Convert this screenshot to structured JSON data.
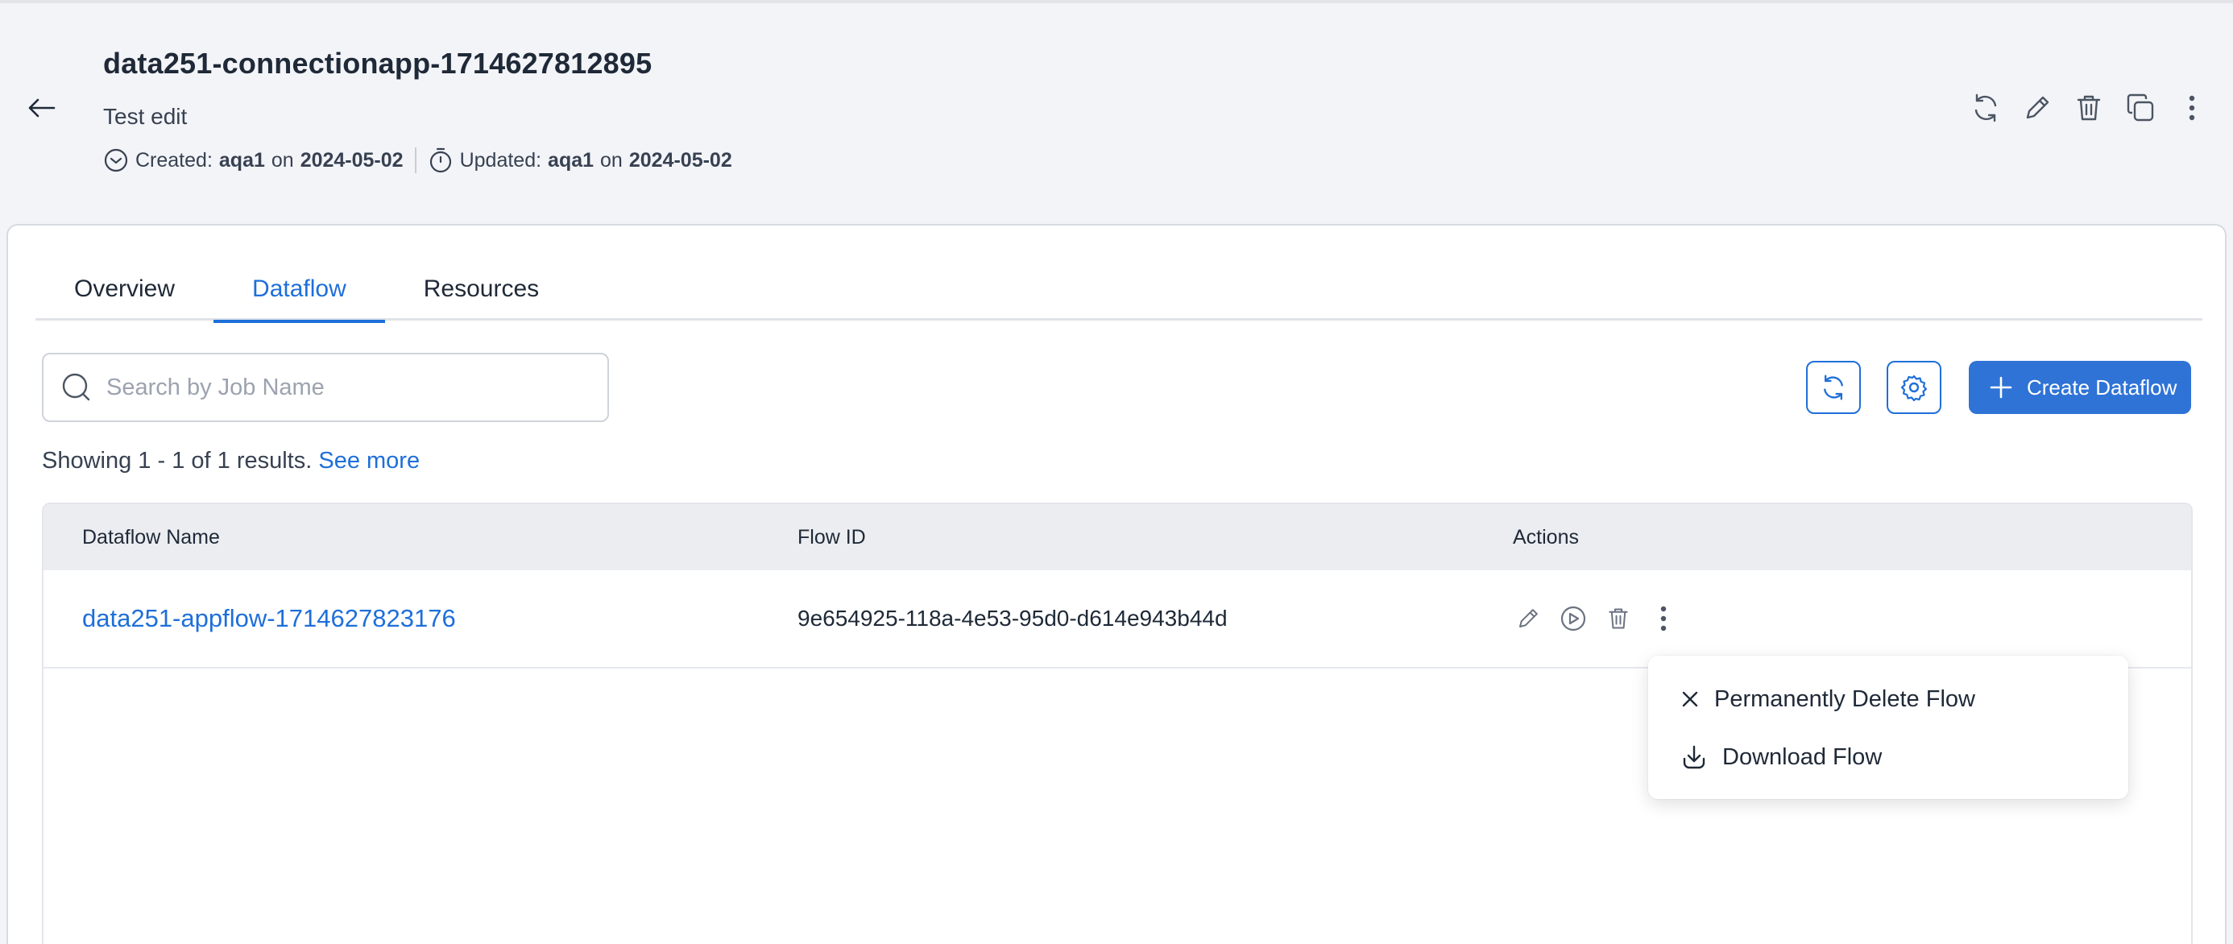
{
  "header": {
    "title": "data251-connectionapp-1714627812895",
    "description": "Test edit",
    "created_label": "Created:",
    "created_user": "aqa1",
    "created_on": "on",
    "created_date": "2024-05-02",
    "updated_label": "Updated:",
    "updated_user": "aqa1",
    "updated_on": "on",
    "updated_date": "2024-05-02",
    "actions": [
      "refresh-icon",
      "edit-icon",
      "trash-icon",
      "copy-icon",
      "more-vertical-icon"
    ]
  },
  "tabs": [
    {
      "label": "Overview",
      "active": false
    },
    {
      "label": "Dataflow",
      "active": true
    },
    {
      "label": "Resources",
      "active": false
    }
  ],
  "search": {
    "placeholder": "Search by Job Name",
    "value": ""
  },
  "toolbar": {
    "create_label": "Create Dataflow"
  },
  "results": {
    "text": "Showing 1 - 1 of 1 results.",
    "link": "See more"
  },
  "table": {
    "columns": [
      "Dataflow Name",
      "Flow ID",
      "Actions"
    ],
    "rows": [
      {
        "name": "data251-appflow-1714627823176",
        "flow_id": "9e654925-118a-4e53-95d0-d614e943b44d"
      }
    ]
  },
  "menu": {
    "items": [
      {
        "label": "Permanently Delete Flow",
        "icon": "close-icon"
      },
      {
        "label": "Download Flow",
        "icon": "download-icon"
      }
    ]
  },
  "colors": {
    "accent": "#1e6fd9",
    "button": "#2f73d6",
    "background": "#f3f4f8"
  }
}
